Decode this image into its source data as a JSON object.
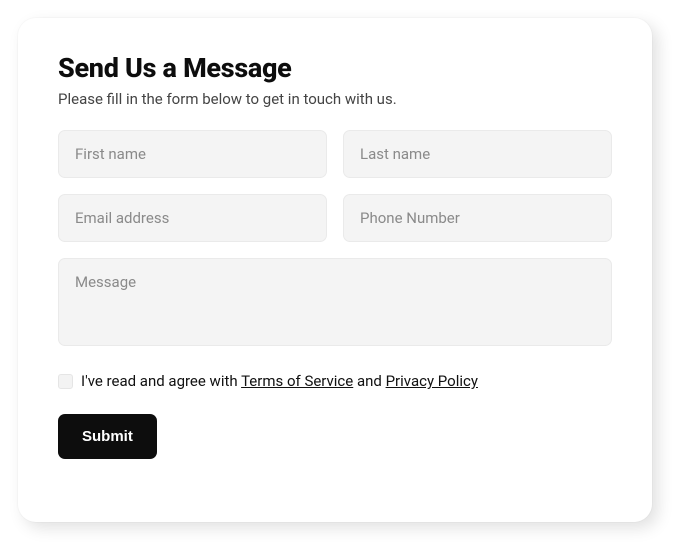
{
  "form": {
    "heading": "Send Us a Message",
    "subheading": "Please fill in the form below to get in touch with us.",
    "fields": {
      "first_name_placeholder": "First name",
      "last_name_placeholder": "Last name",
      "email_placeholder": "Email address",
      "phone_placeholder": "Phone Number",
      "message_placeholder": "Message"
    },
    "consent": {
      "prefix": "I've read and agree with ",
      "terms_label": "Terms of Service",
      "middle": " and ",
      "privacy_label": "Privacy Policy"
    },
    "submit_label": "Submit"
  }
}
